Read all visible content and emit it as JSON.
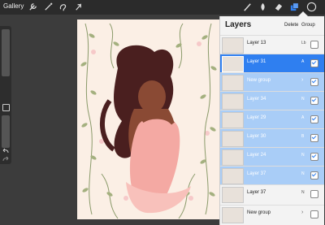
{
  "topbar": {
    "gallery_label": "Gallery"
  },
  "layers_panel": {
    "title": "Layers",
    "delete_label": "Delete",
    "group_label": "Group",
    "rows": [
      {
        "name": "Layer 13",
        "blend": "Lb",
        "state": "normal",
        "kind": "layer",
        "checked": false
      },
      {
        "name": "Layer 31",
        "blend": "A",
        "state": "selected",
        "kind": "layer",
        "checked": true
      },
      {
        "name": "New group",
        "blend": "",
        "state": "highlight",
        "kind": "group",
        "checked": true
      },
      {
        "name": "Layer 34",
        "blend": "N",
        "state": "highlight",
        "kind": "layer",
        "checked": true
      },
      {
        "name": "Layer 29",
        "blend": "A",
        "state": "highlight",
        "kind": "layer",
        "checked": true
      },
      {
        "name": "Layer 30",
        "blend": "B",
        "state": "highlight",
        "kind": "layer",
        "checked": true
      },
      {
        "name": "Layer 24",
        "blend": "N",
        "state": "highlight",
        "kind": "layer",
        "checked": true
      },
      {
        "name": "Layer 37",
        "blend": "N",
        "state": "highlight",
        "kind": "layer",
        "checked": true
      },
      {
        "name": "Layer 37",
        "blend": "N",
        "state": "normal",
        "kind": "layer",
        "checked": false
      },
      {
        "name": "New group",
        "blend": "",
        "state": "normal",
        "kind": "group",
        "checked": false
      }
    ]
  },
  "colors": {
    "accent": "#2f7ff0",
    "highlight": "#a9cdf7",
    "canvas": "#fbefe5"
  }
}
